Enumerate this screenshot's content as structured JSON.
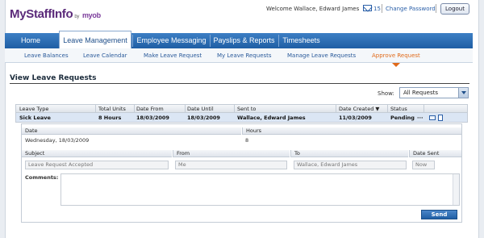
{
  "header": {
    "logo_main": "MyStaffInfo",
    "logo_by": "by",
    "logo_brand": "myob",
    "welcome": "Welcome Wallace, Edward James",
    "message_count": "15",
    "change_password": "Change Password",
    "logout": "Logout"
  },
  "nav": {
    "tabs": [
      "Home",
      "Leave Management",
      "Employee Messaging",
      "Payslips & Reports",
      "Timesheets"
    ]
  },
  "subnav": {
    "items": [
      "Leave Balances",
      "Leave Calendar",
      "Make Leave Request",
      "My Leave Requests",
      "Manage Leave Requests",
      "Approve Request"
    ]
  },
  "page": {
    "title": "View Leave Requests",
    "show_label": "Show:",
    "show_value": "All Requests"
  },
  "table": {
    "columns": [
      "Leave Type",
      "Total Units",
      "Date From",
      "Date Until",
      "Sent to",
      "Date Created ▼",
      "Status"
    ],
    "row": {
      "leave_type": "Sick Leave",
      "total_units": "8 Hours",
      "date_from": "18/03/2009",
      "date_until": "18/03/2009",
      "sent_to": "Wallace, Edward James",
      "date_created": "11/03/2009",
      "status": "Pending",
      "more": "···"
    }
  },
  "detail": {
    "date_header": "Date",
    "hours_header": "Hours",
    "date_value": "Wednesday, 18/03/2009",
    "hours_value": "8",
    "subject_header": "Subject",
    "from_header": "From",
    "to_header": "To",
    "date_sent_header": "Date Sent",
    "subject_value": "Leave Request Accepted",
    "from_value": "Me",
    "to_value": "Wallace, Edward James",
    "date_sent_value": "Now",
    "comments_label": "Comments:",
    "send": "Send"
  },
  "colors": {
    "accent": "#1f5ea4",
    "active_sub": "#e06a1a",
    "brand": "#5b2a7a"
  }
}
